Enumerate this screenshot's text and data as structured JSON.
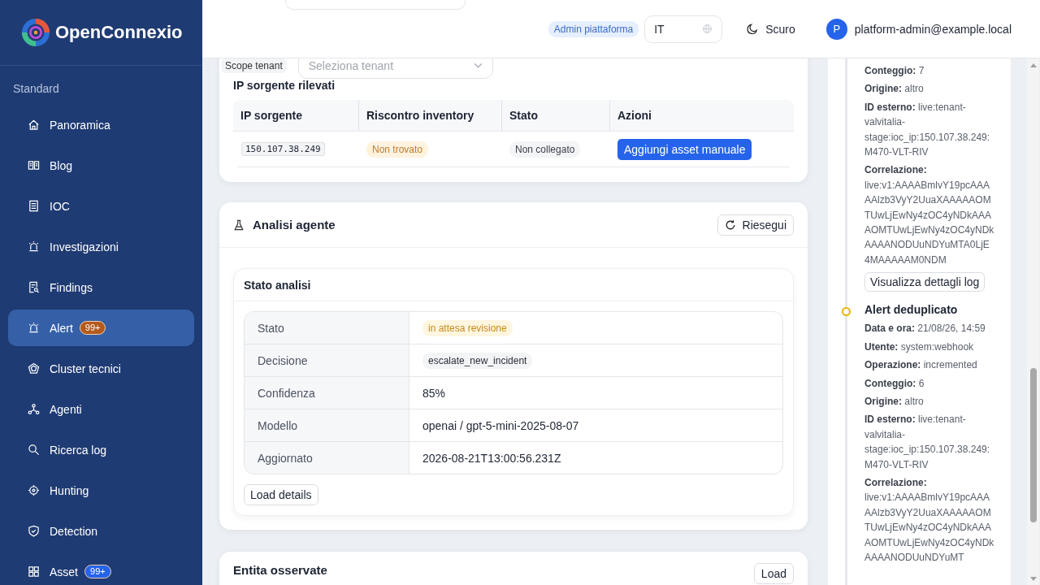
{
  "brand": {
    "name": "OpenConnexio"
  },
  "sidebar": {
    "section": "Standard",
    "items": [
      {
        "label": "Panoramica",
        "selected": false
      },
      {
        "label": "Blog",
        "selected": false
      },
      {
        "label": "IOC",
        "selected": false
      },
      {
        "label": "Investigazioni",
        "selected": false
      },
      {
        "label": "Findings",
        "selected": false
      },
      {
        "label": "Alert",
        "selected": true,
        "badge": {
          "text": "99+",
          "color": "#b45a1c"
        }
      },
      {
        "label": "Cluster tecnici",
        "selected": false
      },
      {
        "label": "Agenti",
        "selected": false
      },
      {
        "label": "Ricerca log",
        "selected": false
      },
      {
        "label": "Hunting",
        "selected": false
      },
      {
        "label": "Detection",
        "selected": false
      },
      {
        "label": "Asset",
        "selected": false,
        "badge": {
          "text": "99+",
          "color": "#2563eb"
        }
      }
    ]
  },
  "header": {
    "role": "Admin piattaforma",
    "language": "IT",
    "theme": "Scuro",
    "avatar": "P",
    "user": "platform-admin@example.local"
  },
  "scope": {
    "label": "Scope tenant",
    "placeholder": "Seleziona tenant"
  },
  "ip_card": {
    "title": "IP sorgente rilevati",
    "columns": [
      "IP sorgente",
      "Riscontro inventory",
      "Stato",
      "Azioni"
    ],
    "rows": [
      {
        "ip": "150.107.38.249",
        "inventory": "Non trovato",
        "status": "Non collegato",
        "action": "Aggiungi asset manuale"
      }
    ]
  },
  "agent_card": {
    "title": "Analisi agente",
    "rerun": "Riesegui",
    "panel_title": "Stato analisi",
    "rows": [
      {
        "label": "Stato",
        "value": "in attesa revisione",
        "kind": "warning"
      },
      {
        "label": "Decisione",
        "value": "escalate_new_incident",
        "kind": "tag"
      },
      {
        "label": "Confidenza",
        "value": "85%",
        "kind": "text"
      },
      {
        "label": "Modello",
        "value": "openai / gpt-5-mini-2025-08-07",
        "kind": "text"
      },
      {
        "label": "Aggiornato",
        "value": "2026-08-21T13:00:56.231Z",
        "kind": "text"
      }
    ],
    "load": "Load details"
  },
  "entities_card": {
    "title": "Entita osservate",
    "load": "Load"
  },
  "timeline": {
    "events": [
      {
        "fields": [
          {
            "label": "Conteggio:",
            "value": "7"
          },
          {
            "label": "Origine:",
            "value": "altro"
          },
          {
            "label": "ID esterno:",
            "value": "live:tenant-valvitalia-stage:ioc_ip:150.107.38.249:M470-VLT-RIV"
          },
          {
            "label": "Correlazione:",
            "value": "live:v1:AAAABmlvY19pcAAAAAlzb3VyY2UuaXAAAAAOMTUwLjEwNy4zOC4yNDkAAAAOMTUwLjEwNy4zOC4yNDkAAAANODUuNDYuMTA0LjE4MAAAAAM0NDM"
          }
        ],
        "button": "Visualizza dettagli log"
      },
      {
        "title": "Alert deduplicato",
        "fields": [
          {
            "label": "Data e ora:",
            "value": "21/08/26, 14:59"
          },
          {
            "label": "Utente:",
            "value": "system:webhook"
          },
          {
            "label": "Operazione:",
            "value": "incremented"
          },
          {
            "label": "Conteggio:",
            "value": "6"
          },
          {
            "label": "Origine:",
            "value": "altro"
          },
          {
            "label": "ID esterno:",
            "value": "live:tenant-valvitalia-stage:ioc_ip:150.107.38.249:M470-VLT-RIV"
          },
          {
            "label": "Correlazione:",
            "value": "live:v1:AAAABmlvY19pcAAAAAlzb3VyY2UuaXAAAAAOMTUwLjEwNy4zOC4yNDkAAAAOMTUwLjEwNy4zOC4yNDkAAAANODUuNDYuMT"
          }
        ]
      }
    ]
  }
}
